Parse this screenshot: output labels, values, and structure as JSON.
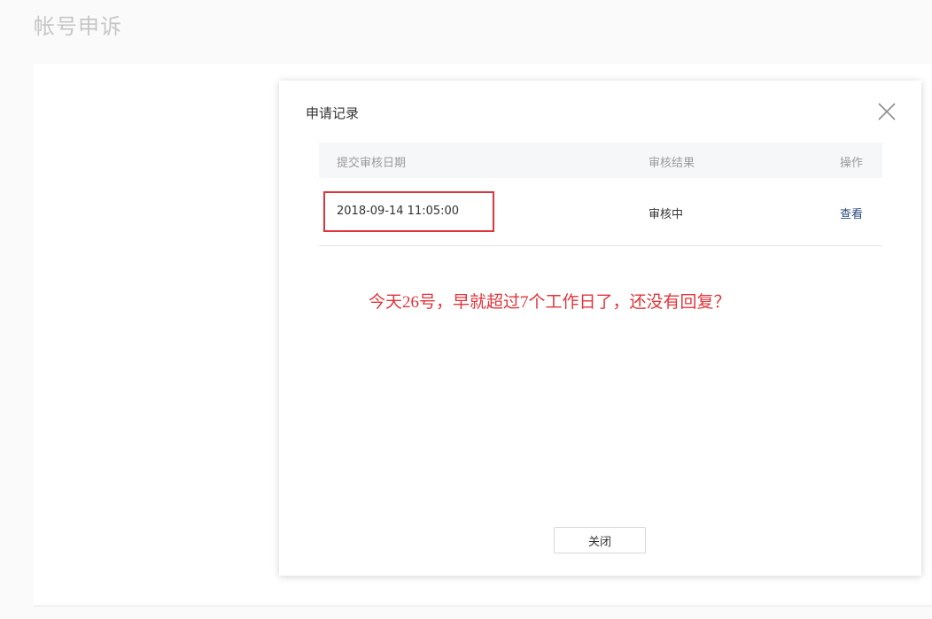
{
  "page": {
    "title": "帐号申诉"
  },
  "dialog": {
    "title": "申请记录",
    "close_button_label": "关闭",
    "table": {
      "headers": {
        "date": "提交审核日期",
        "result": "审核结果",
        "action": "操作"
      },
      "rows": [
        {
          "date": "2018-09-14 11:05:00",
          "result": "审核中",
          "action": "查看"
        }
      ]
    },
    "annotation": "今天26号，早就超过7个工作日了，还没有回复？"
  },
  "colors": {
    "annotation_red": "#e0343a",
    "link_blue": "#2d4b7c",
    "header_bg": "#f6f7f9"
  }
}
